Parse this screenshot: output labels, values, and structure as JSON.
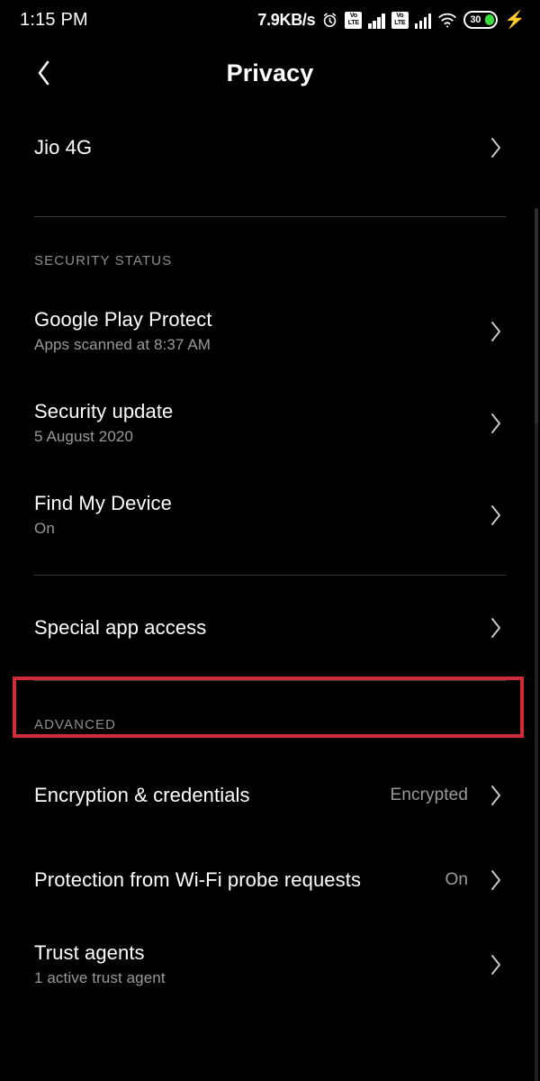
{
  "statusbar": {
    "clock": "1:15 PM",
    "network_speed": "7.9KB/s",
    "alarm_icon": "alarm-icon",
    "sim1_volte": "VoLTE",
    "sim2_volte": "VoLTE",
    "wifi_icon": "wifi-icon",
    "battery_level": "30",
    "charging_icon": "lightning-bolt-icon"
  },
  "appbar": {
    "back_icon": "back-chevron-icon",
    "title": "Privacy"
  },
  "colors": {
    "background": "#000000",
    "primary_text": "#ffffff",
    "secondary_text": "#9a9a9a",
    "divider": "#3a3a3a",
    "highlight": "#cf2b38",
    "battery_green": "#3ddc3d"
  },
  "rows": {
    "carrier": {
      "title": "Jio 4G",
      "chevron": "chevron-right-icon"
    },
    "play_protect": {
      "title": "Google Play Protect",
      "subtitle": "Apps scanned at 8:37 AM",
      "chevron": "chevron-right-icon"
    },
    "security_update": {
      "title": "Security update",
      "subtitle": "5 August 2020",
      "chevron": "chevron-right-icon"
    },
    "find_my_device": {
      "title": "Find My Device",
      "subtitle": "On",
      "chevron": "chevron-right-icon"
    },
    "special_app_access": {
      "title": "Special app access",
      "chevron": "chevron-right-icon"
    },
    "encryption": {
      "title": "Encryption & credentials",
      "value": "Encrypted",
      "chevron": "chevron-right-icon"
    },
    "wifi_probe": {
      "title": "Protection from Wi-Fi probe requests",
      "value": "On",
      "chevron": "chevron-right-icon"
    },
    "trust_agents": {
      "title": "Trust agents",
      "subtitle": "1 active trust agent",
      "chevron": "chevron-right-icon"
    }
  },
  "sections": {
    "security_status": "SECURITY STATUS",
    "advanced": "ADVANCED"
  }
}
